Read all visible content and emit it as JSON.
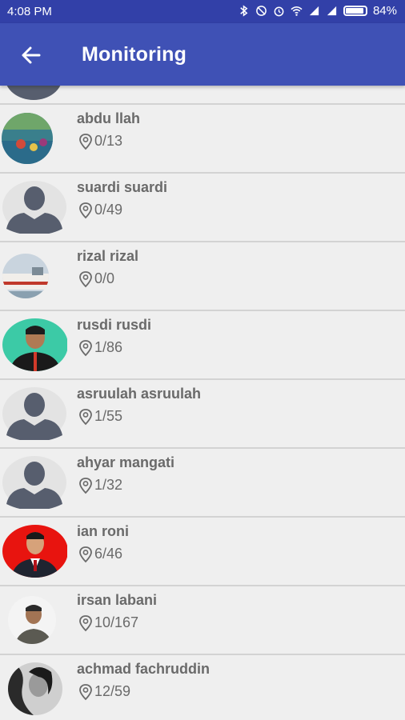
{
  "status_bar": {
    "time": "4:08 PM",
    "battery": "84%"
  },
  "app_bar": {
    "title": "Monitoring"
  },
  "contacts": [
    {
      "name": "abdu llah",
      "count": "0/13",
      "avatar": "photo-water"
    },
    {
      "name": "suardi suardi",
      "count": "0/49",
      "avatar": "placeholder"
    },
    {
      "name": "rizal rizal",
      "count": "0/0",
      "avatar": "photo-boat"
    },
    {
      "name": "rusdi rusdi",
      "count": "1/86",
      "avatar": "photo-portrait-teal"
    },
    {
      "name": "asruulah asruulah",
      "count": "1/55",
      "avatar": "placeholder"
    },
    {
      "name": "ahyar mangati",
      "count": "1/32",
      "avatar": "placeholder"
    },
    {
      "name": "ian roni",
      "count": "6/46",
      "avatar": "photo-portrait-red"
    },
    {
      "name": "irsan labani",
      "count": "10/167",
      "avatar": "photo-man"
    },
    {
      "name": "achmad fachruddin",
      "count": "12/59",
      "avatar": "photo-bw"
    }
  ],
  "colors": {
    "app_bar": "#3f51b5",
    "status_bar": "#3240a8",
    "text": "#6a6a6a",
    "placeholder": "#575e6e"
  }
}
